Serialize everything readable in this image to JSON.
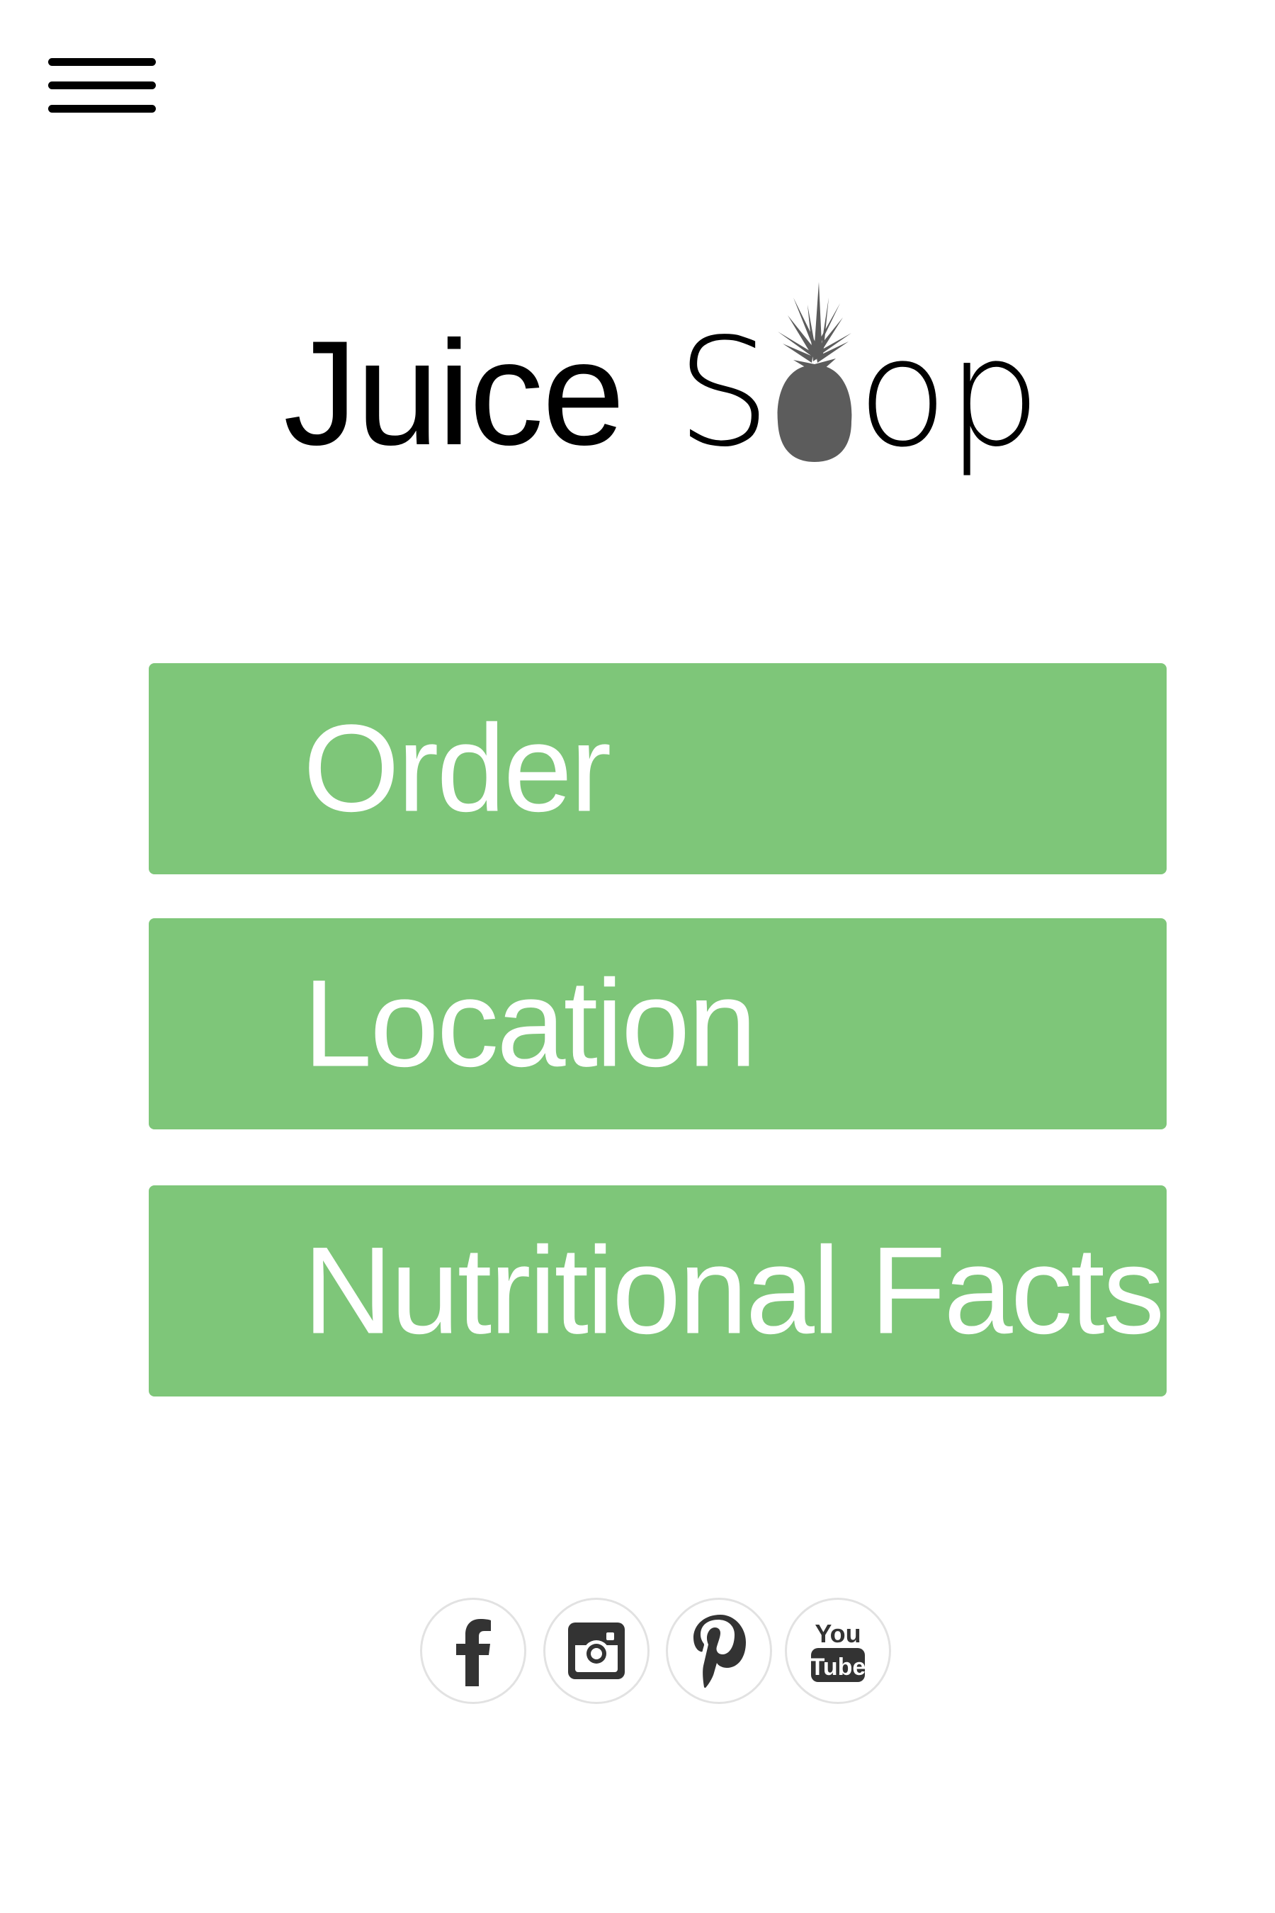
{
  "header": {
    "menu_icon": "hamburger-menu-icon"
  },
  "logo": {
    "word1": "Juice",
    "word2_start": "S",
    "word2_end": "op",
    "mark_icon": "pineapple-icon",
    "mark_color": "#5c5c5c"
  },
  "nav": {
    "items": [
      {
        "label": "Order"
      },
      {
        "label": "Location"
      },
      {
        "label": "Nutritional Facts"
      }
    ],
    "button_color": "#7ec679",
    "text_color": "#ffffff"
  },
  "social": {
    "items": [
      {
        "icon": "facebook-icon"
      },
      {
        "icon": "instagram-icon"
      },
      {
        "icon": "pinterest-icon"
      },
      {
        "icon": "youtube-icon",
        "text_top": "You",
        "text_bottom": "Tube"
      }
    ],
    "icon_color": "#333333",
    "border_color": "#e2e2e2"
  }
}
